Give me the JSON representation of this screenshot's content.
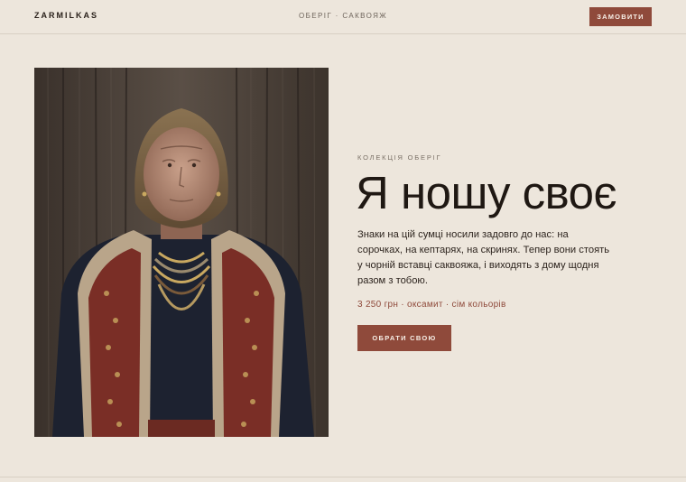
{
  "header": {
    "brand": "ZARMILKAS",
    "nav_text": "ОБЕРІГ · САКВОЯЖ",
    "order_label": "ЗАМОВИТИ"
  },
  "hero": {
    "image_icon": "portrait-photo",
    "eyebrow": "КОЛЕКЦІЯ ОБЕРІГ",
    "title": "Я ношу своє",
    "body": "Знаки на цій сумці носили задовго до нас: на сорочках, на кептарях, на скринях. Тепер вони стоять у чорній вставці саквояжа, і виходять з дому щодня разом з тобою.",
    "meta": "3 250 грн · оксамит · сім кольорів",
    "cta_label": "ОБРАТИ СВОЮ"
  },
  "colors": {
    "background": "#ede6dc",
    "accent": "#8f4a3b",
    "text": "#241b15"
  }
}
